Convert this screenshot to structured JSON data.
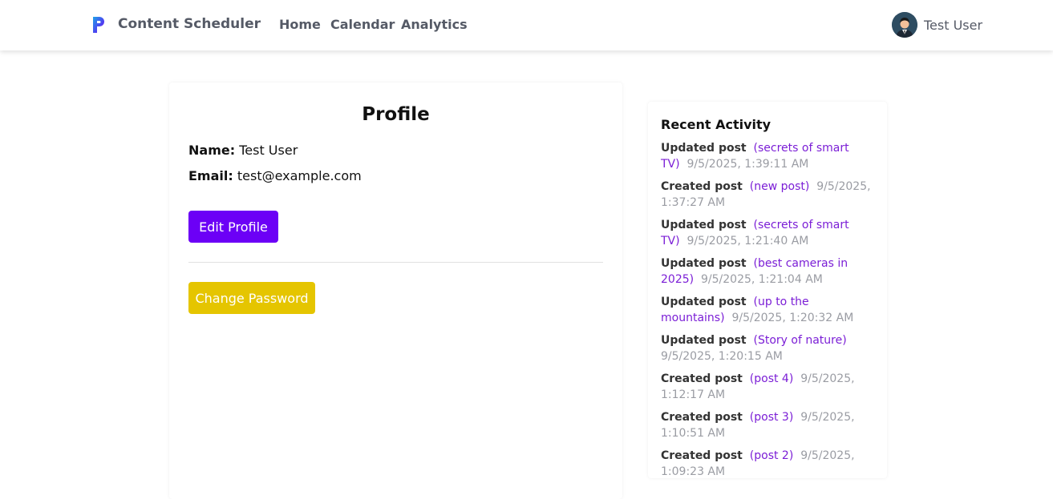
{
  "app": {
    "name": "Content Scheduler",
    "accent": "#6c00f6"
  },
  "nav": {
    "links": [
      {
        "label": "Home"
      },
      {
        "label": "Calendar"
      },
      {
        "label": "Analytics"
      }
    ],
    "user_name": "Test User"
  },
  "profile": {
    "title": "Profile",
    "name_label": "Name:",
    "name_value": "Test User",
    "email_label": "Email:",
    "email_value": "test@example.com",
    "edit_button": "Edit Profile",
    "change_password_button": "Change Password"
  },
  "activity": {
    "title": "Recent Activity",
    "items": [
      {
        "action": "Updated post",
        "post": "(secrets of smart TV)",
        "time": "9/5/2025, 1:39:11 AM"
      },
      {
        "action": "Created post",
        "post": "(new post)",
        "time": "9/5/2025, 1:37:27 AM"
      },
      {
        "action": "Updated post",
        "post": "(secrets of smart TV)",
        "time": "9/5/2025, 1:21:40 AM"
      },
      {
        "action": "Updated post",
        "post": "(best cameras in 2025)",
        "time": "9/5/2025, 1:21:04 AM"
      },
      {
        "action": "Updated post",
        "post": "(up to the mountains)",
        "time": "9/5/2025, 1:20:32 AM"
      },
      {
        "action": "Updated post",
        "post": "(Story of nature)",
        "time": "9/5/2025, 1:20:15 AM"
      },
      {
        "action": "Created post",
        "post": "(post 4)",
        "time": "9/5/2025, 1:12:17 AM"
      },
      {
        "action": "Created post",
        "post": "(post 3)",
        "time": "9/5/2025, 1:10:51 AM"
      },
      {
        "action": "Created post",
        "post": "(post 2)",
        "time": "9/5/2025, 1:09:23 AM"
      }
    ]
  }
}
